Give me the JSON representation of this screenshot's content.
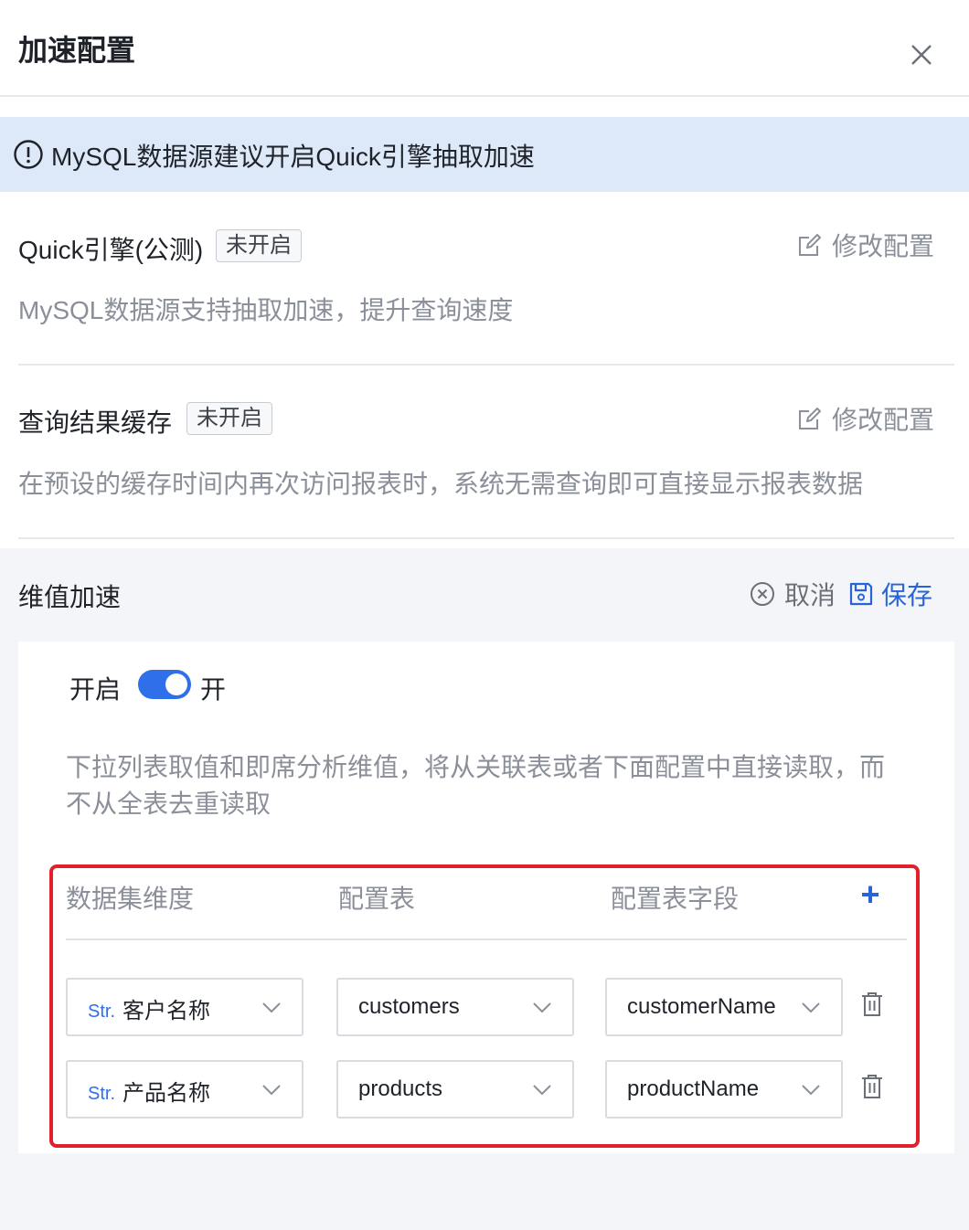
{
  "header": {
    "title": "加速配置"
  },
  "alert": {
    "text": "MySQL数据源建议开启Quick引擎抽取加速"
  },
  "quick": {
    "title": "Quick引擎(公测)",
    "badge": "未开启",
    "edit_label": "修改配置",
    "desc": "MySQL数据源支持抽取加速，提升查询速度"
  },
  "cache": {
    "title": "查询结果缓存",
    "badge": "未开启",
    "edit_label": "修改配置",
    "desc": "在预设的缓存时间内再次访问报表时，系统无需查询即可直接显示报表数据"
  },
  "dim": {
    "title": "维值加速",
    "cancel_label": "取消",
    "save_label": "保存",
    "toggle_label": "开启",
    "toggle_state": "开",
    "toggle_on": true,
    "desc": "下拉列表取值和即席分析维值，将从关联表或者下面配置中直接读取，而不从全表去重读取",
    "columns": [
      "数据集维度",
      "配置表",
      "配置表字段"
    ],
    "add_label": "+",
    "rows": [
      {
        "type": "Str.",
        "dimension": "客户名称",
        "table": "customers",
        "field": "customerName"
      },
      {
        "type": "Str.",
        "dimension": "产品名称",
        "table": "products",
        "field": "productName"
      }
    ]
  },
  "colors": {
    "accent": "#2f6fea",
    "highlight": "#e0202c",
    "alert_bg": "#dde8f8"
  }
}
